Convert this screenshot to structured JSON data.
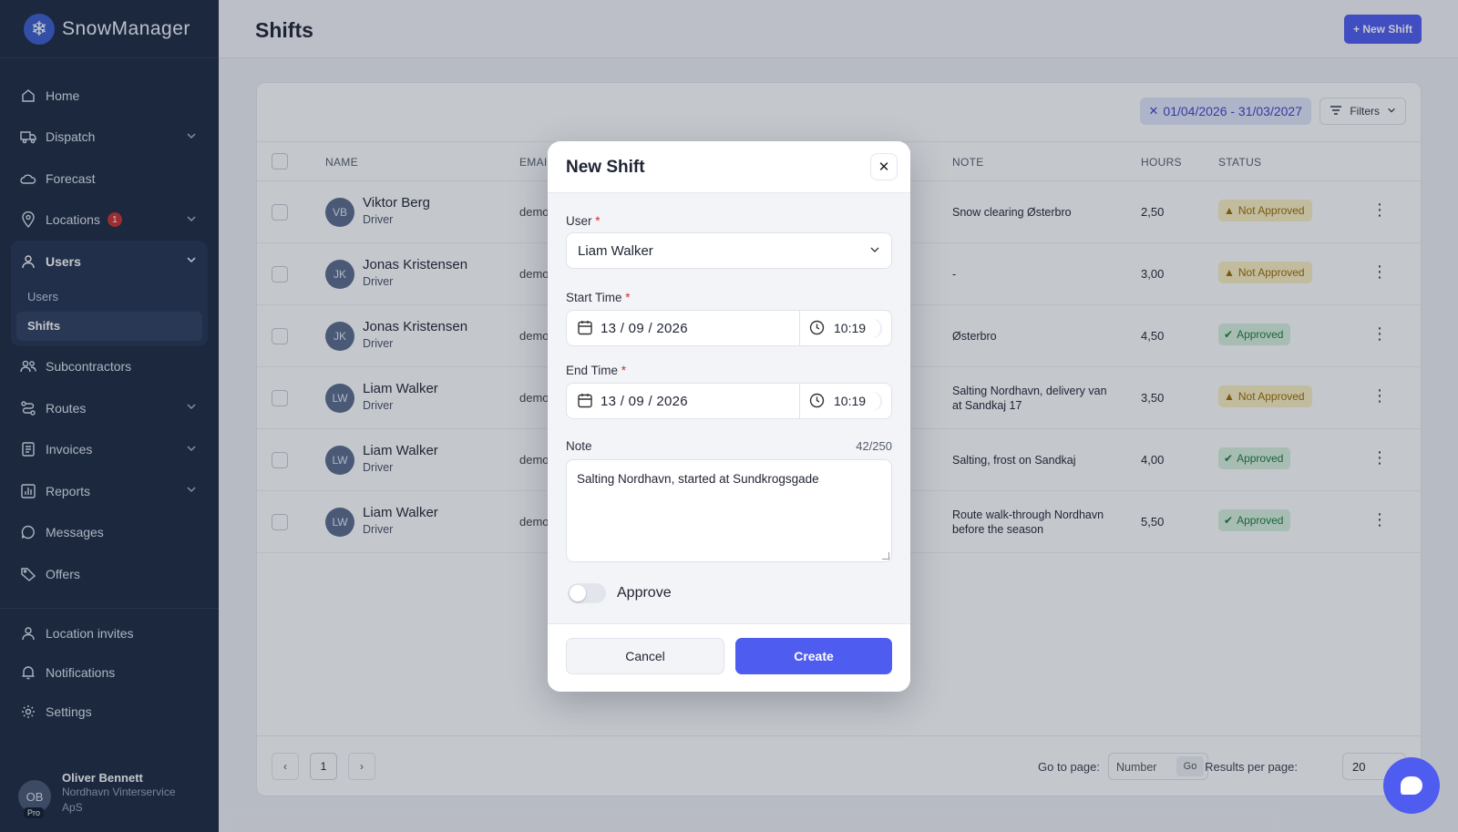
{
  "app": {
    "name": "SnowManager"
  },
  "sidebar": {
    "items": [
      {
        "label": "Home",
        "icon": "home-icon"
      },
      {
        "label": "Dispatch",
        "icon": "truck-icon"
      },
      {
        "label": "Forecast",
        "icon": "cloud-icon"
      },
      {
        "label": "Locations",
        "icon": "map-pin-icon",
        "badge": "1"
      },
      {
        "label": "Users",
        "icon": "user-icon"
      },
      {
        "label": "Subcontractors",
        "icon": "users-icon"
      },
      {
        "label": "Routes",
        "icon": "route-icon"
      },
      {
        "label": "Invoices",
        "icon": "invoice-icon"
      },
      {
        "label": "Reports",
        "icon": "chart-icon"
      },
      {
        "label": "Messages",
        "icon": "message-icon"
      },
      {
        "label": "Offers",
        "icon": "tag-icon"
      }
    ],
    "users_sub": [
      {
        "label": "Users"
      },
      {
        "label": "Shifts"
      }
    ],
    "bottom": [
      {
        "label": "Location invites",
        "icon": "invite-icon"
      },
      {
        "label": "Notifications",
        "icon": "bell-icon"
      },
      {
        "label": "Settings",
        "icon": "gear-icon"
      }
    ],
    "profile": {
      "initials": "OB",
      "tag": "Pro",
      "name": "Oliver Bennett",
      "org": "Nordhavn Vinterservice ApS"
    }
  },
  "header": {
    "title": "Shifts",
    "new_button": "+ New Shift"
  },
  "filters": {
    "date_range": "01/04/2026 - 31/03/2027",
    "filters_label": "Filters"
  },
  "table": {
    "columns": {
      "name": "NAME",
      "email": "EMAIL",
      "note": "NOTE",
      "hours": "HOURS",
      "status": "STATUS"
    },
    "rows": [
      {
        "initials": "VB",
        "name": "Viktor Berg",
        "role": "Driver",
        "email": "demo",
        "note": "Snow clearing Østerbro",
        "hours": "2,50",
        "status": "Not Approved"
      },
      {
        "initials": "JK",
        "name": "Jonas Kristensen",
        "role": "Driver",
        "email": "demo",
        "note": "-",
        "hours": "3,00",
        "status": "Not Approved"
      },
      {
        "initials": "JK",
        "name": "Jonas Kristensen",
        "role": "Driver",
        "email": "demo",
        "note": "Østerbro",
        "hours": "4,50",
        "status": "Approved"
      },
      {
        "initials": "LW",
        "name": "Liam Walker",
        "role": "Driver",
        "email": "demo",
        "note": "Salting Nordhavn, delivery van at Sandkaj 17",
        "hours": "3,50",
        "status": "Not Approved"
      },
      {
        "initials": "LW",
        "name": "Liam Walker",
        "role": "Driver",
        "email": "demo",
        "note": "Salting, frost on Sandkaj",
        "hours": "4,00",
        "status": "Approved"
      },
      {
        "initials": "LW",
        "name": "Liam Walker",
        "role": "Driver",
        "email": "demo",
        "note": "Route walk-through Nordhavn before the season",
        "hours": "5,50",
        "status": "Approved"
      }
    ]
  },
  "pagination": {
    "page": "1",
    "goto_label": "Go to page:",
    "goto_placeholder": "Number",
    "go": "Go",
    "rpp_label": "Results per page:",
    "rpp_value": "20"
  },
  "modal": {
    "title": "New Shift",
    "user_label": "User",
    "user_value": "Liam Walker",
    "start_label": "Start Time",
    "start_date": "13 / 09 / 2026",
    "start_time": "10:19",
    "end_label": "End Time",
    "end_date": "13 / 09 / 2026",
    "end_time": "10:19",
    "note_label": "Note",
    "note_counter": "42/250",
    "note_value": "Salting Nordhavn, started at Sundkrogsgade",
    "approve_label": "Approve",
    "approve_on": false,
    "cancel": "Cancel",
    "create": "Create"
  },
  "colors": {
    "primary": "#4f5cf0",
    "sidebar": "#1c2940",
    "warning": "#fdf0c2",
    "success": "#d8f2de",
    "required": "#d12f2f"
  }
}
